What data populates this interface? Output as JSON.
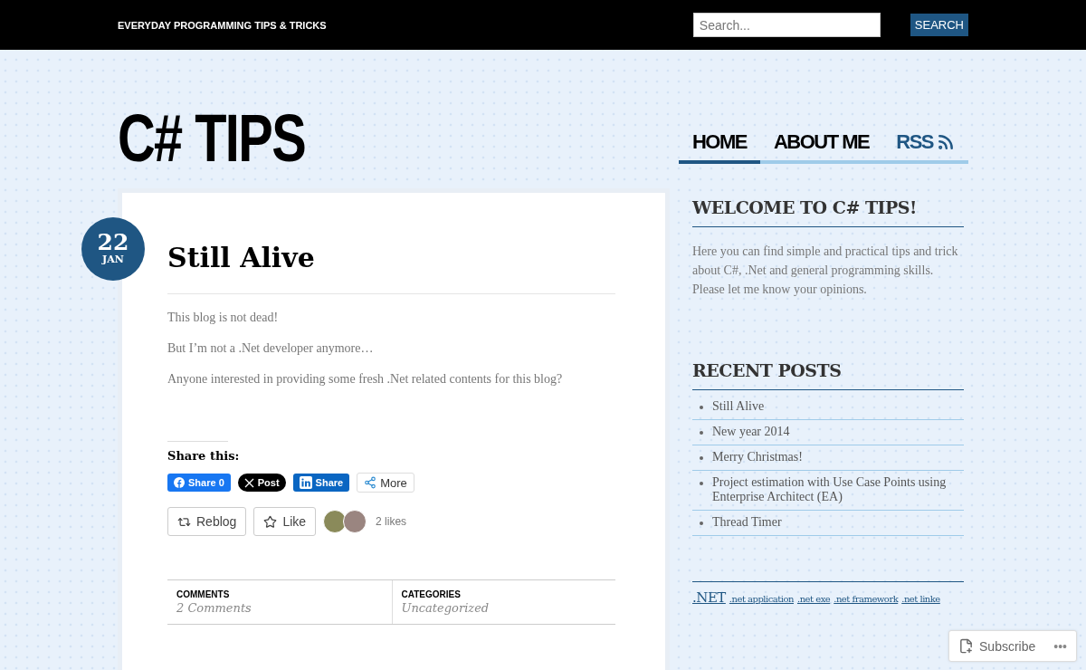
{
  "top_bar": {
    "tagline": "EVERYDAY PROGRAMMING TIPS & TRICKS",
    "search": {
      "placeholder": "Search...",
      "button": "SEARCH"
    }
  },
  "site_title": "C# TIPS",
  "nav": [
    {
      "label": "HOME",
      "selected": true,
      "kind": "link"
    },
    {
      "label": "ABOUT ME",
      "selected": false,
      "kind": "link"
    },
    {
      "label": "RSS",
      "selected": false,
      "kind": "feed"
    }
  ],
  "post": {
    "date": {
      "day": "22",
      "month": "JAN"
    },
    "title": "Still Alive",
    "paragraphs": [
      "This blog is not dead!",
      "But I’m not a .Net developer anymore…",
      "Anyone interested in providing some fresh .Net related contents for this blog?"
    ],
    "share_heading": "Share this:",
    "share_buttons": [
      {
        "kind": "facebook",
        "label": "Share 0"
      },
      {
        "kind": "x",
        "label": "Post"
      },
      {
        "kind": "linkedin",
        "label": "Share"
      },
      {
        "kind": "more",
        "label": "More"
      }
    ],
    "reblog": "Reblog",
    "like": "Like",
    "likes_count": "2 likes",
    "meta": [
      {
        "heading": "COMMENTS",
        "value": "2 Comments"
      },
      {
        "heading": "CATEGORIES",
        "value": "Uncategorized"
      }
    ]
  },
  "sidebar": {
    "welcome": {
      "title": "WELCOME TO C# TIPS!",
      "text": "Here you can find simple and practical tips and trick about C#, .Net and general programming skills.",
      "text2": "Please let me know your opinions."
    },
    "recent": {
      "title": "RECENT POSTS",
      "items": [
        "Still Alive",
        "New year 2014",
        "Merry Christmas!",
        "Project estimation with Use Case Points using Enterprise Architect (EA)",
        "Thread Timer"
      ]
    },
    "tags": [
      {
        "label": ".NET",
        "kind": "major"
      },
      {
        "label": ".net application",
        "kind": "minor"
      },
      {
        "label": ".net exe",
        "kind": "minor"
      },
      {
        "label": ".net framework",
        "kind": "minor"
      },
      {
        "label": ".net linke",
        "kind": "minor"
      }
    ]
  },
  "subscribe": {
    "label": "Subscribe",
    "more": "•••"
  }
}
